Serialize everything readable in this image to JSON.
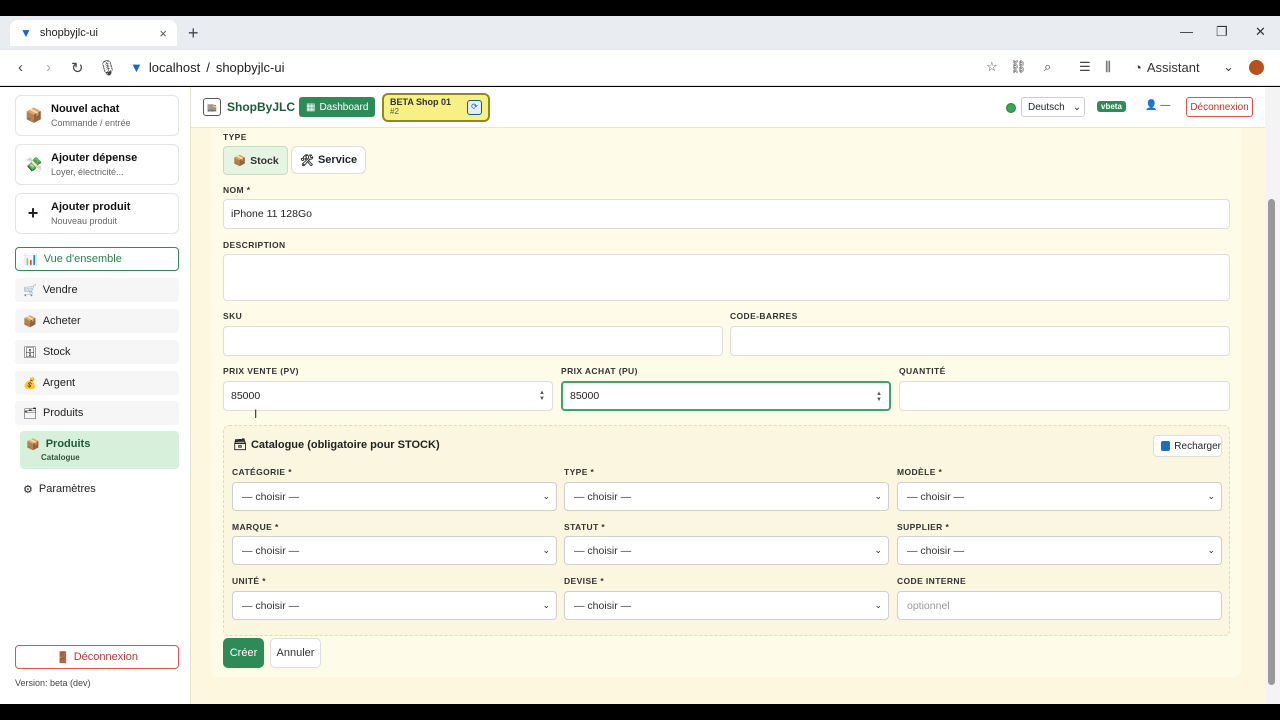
{
  "browser": {
    "tab_title": "shopbyjlc-ui",
    "url_host": "localhost",
    "url_path": "shopbyjlc-ui",
    "url_sep": "/",
    "assistant_label": "Assistant"
  },
  "sidebar": {
    "quick_actions": [
      {
        "title": "Nouvel achat",
        "subtitle": "Commande / entrée"
      },
      {
        "title": "Ajouter dépense",
        "subtitle": "Loyer, électricité..."
      },
      {
        "title": "Ajouter produit",
        "subtitle": "Nouveau produit"
      }
    ],
    "nav": [
      {
        "label": "Vue d'ensemble"
      },
      {
        "label": "Vendre"
      },
      {
        "label": "Acheter"
      },
      {
        "label": "Stock"
      },
      {
        "label": "Argent"
      },
      {
        "label": "Produits"
      }
    ],
    "active_group": {
      "label": "Produits",
      "sub": "Catalogue"
    },
    "settings_label": "Paramètres",
    "logout_label": "Déconnexion",
    "version": "Version: beta (dev)"
  },
  "header": {
    "brand": "ShopByJLC",
    "dashboard_label": "Dashboard",
    "shop_name": "BETA Shop 01",
    "shop_id": "#2",
    "language": "Deutsch",
    "badge": "vbeta",
    "user_placeholder": "—",
    "logout_label": "Déconnexion"
  },
  "form": {
    "type_label": "TYPE",
    "type_options": [
      {
        "label": "Stock"
      },
      {
        "label": "Service"
      }
    ],
    "name_label": "NOM *",
    "name_value": "iPhone 11 128Go",
    "description_label": "DESCRIPTION",
    "description_value": "",
    "sku_label": "SKU",
    "sku_value": "",
    "barcode_label": "CODE-BARRES",
    "barcode_value": "",
    "sale_price_label": "PRIX VENTE (PV)",
    "sale_price_value": "85000",
    "purchase_price_label": "PRIX ACHAT (PU)",
    "purchase_price_value": "85000",
    "quantity_label": "QUANTITÉ",
    "quantity_value": "",
    "catalogue": {
      "title": "Catalogue (obligatoire pour STOCK)",
      "reload_label": "Recharger",
      "fields": {
        "categorie": {
          "label": "CATÉGORIE *",
          "value": "— choisir —"
        },
        "type": {
          "label": "TYPE *",
          "value": "— choisir —"
        },
        "modele": {
          "label": "MODÈLE *",
          "value": "— choisir —"
        },
        "marque": {
          "label": "MARQUE *",
          "value": "— choisir —"
        },
        "statut": {
          "label": "STATUT *",
          "value": "— choisir —"
        },
        "supplier": {
          "label": "SUPPLIER *",
          "value": "— choisir —"
        },
        "unite": {
          "label": "UNITÉ *",
          "value": "— choisir —"
        },
        "devise": {
          "label": "DEVISE *",
          "value": "— choisir —"
        },
        "code_interne": {
          "label": "CODE INTERNE",
          "placeholder": "optionnel"
        }
      }
    },
    "create_label": "Créer",
    "cancel_label": "Annuler"
  },
  "colors": {
    "accent_green": "#2e8b57",
    "page_bg": "#fdf7df",
    "danger": "#d9534f"
  }
}
